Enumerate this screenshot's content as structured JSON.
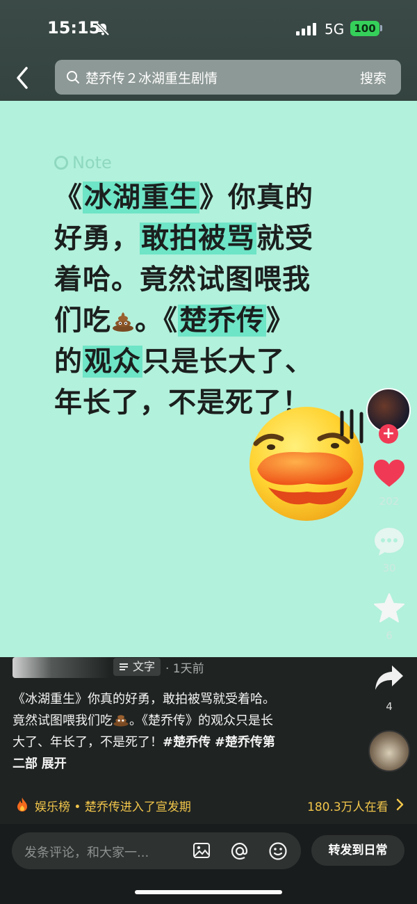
{
  "status_bar": {
    "time": "15:15",
    "network": "5G",
    "battery": "100"
  },
  "search": {
    "query": "楚乔传２冰湖重生剧情",
    "button": "搜索"
  },
  "note": {
    "label": "Note",
    "line1_a": "《",
    "line1_hl": "冰湖重生",
    "line1_b": "》你真的",
    "line2_a": "好勇，",
    "line2_hl": "敢拍被骂",
    "line2_b": "就受",
    "line3": "着哈。竟然试图喂我",
    "line4_a": "们吃",
    "line4_b": "。《",
    "line4_hl": "楚乔传",
    "line4_c": "》",
    "line5_a": "的",
    "line5_hl": "观众",
    "line5_b": "只是长大了、",
    "line6": "年长了，不是死了！"
  },
  "actions": {
    "likes": "202",
    "comments": "30",
    "favorites": "6",
    "shares": "4",
    "follow_symbol": "+"
  },
  "post": {
    "tag": "文字",
    "time_ago": "· 1天前",
    "desc_1": "《冰湖重生》你真的好勇，敢拍被骂就受着哈。",
    "desc_2a": "竟然试图喂我们吃",
    "desc_2b": "。《楚乔传》的观众只是长",
    "desc_3": "大了、年长了，不是死了！",
    "hashtag_1": "#楚乔传",
    "hashtag_2": "#楚乔传第",
    "desc_4": "二部",
    "more": "展开"
  },
  "hot": {
    "text": "娱乐榜 • 楚乔传进入了宣发期",
    "viewers": "180.3万人在看"
  },
  "comment_bar": {
    "placeholder": "发条评论，和大家一...",
    "forward": "转发到日常"
  },
  "colors": {
    "note_bg": "#b2f1dc",
    "highlight": "#6ee5c6",
    "like": "#f03a55",
    "hot": "#f2c64b"
  },
  "icons": [
    "back-icon",
    "search-icon",
    "heart-icon",
    "comment-icon",
    "star-icon",
    "share-icon",
    "fire-icon",
    "image-icon",
    "at-icon",
    "emoji-icon"
  ]
}
